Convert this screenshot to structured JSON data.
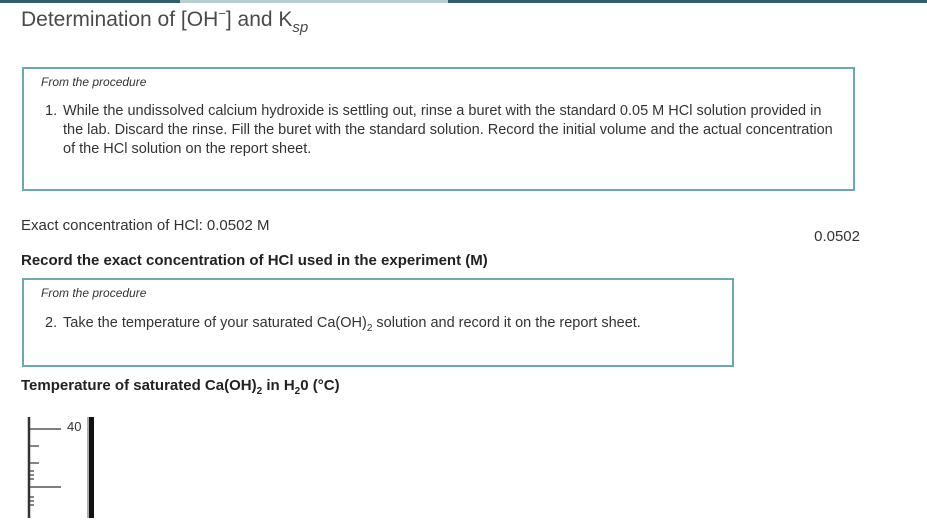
{
  "page": {
    "title_main": "Determination of [OH",
    "title_minus": "−",
    "title_mid": "] and K",
    "title_sub": "sp"
  },
  "procedure1": {
    "label": "From the procedure",
    "number": "1.",
    "text": "While the undissolved calcium hydroxide is settling out, rinse a buret with the standard 0.05 M HCl solution provided in the lab. Discard the rinse. Fill the buret with the standard solution. Record the initial volume and the actual concentration of the HCl solution on the report sheet."
  },
  "exact_concentration": {
    "text": "Exact concentration of HCl: 0.0502 M",
    "answer": "0.0502"
  },
  "question1": {
    "text": "Record the exact concentration of HCl used in the experiment (M)"
  },
  "procedure2": {
    "label": "From the procedure",
    "number": "2.",
    "text_before": "Take the temperature of your saturated Ca(OH)",
    "text_sub": "2",
    "text_after": " solution and record it on the report sheet."
  },
  "question2": {
    "text_before": "Temperature of saturated Ca(OH)",
    "sub1": "2",
    "text_mid": " in H",
    "sub2": "2",
    "text_after": "0 (°C)"
  },
  "thermometer": {
    "scale_label": "40"
  }
}
